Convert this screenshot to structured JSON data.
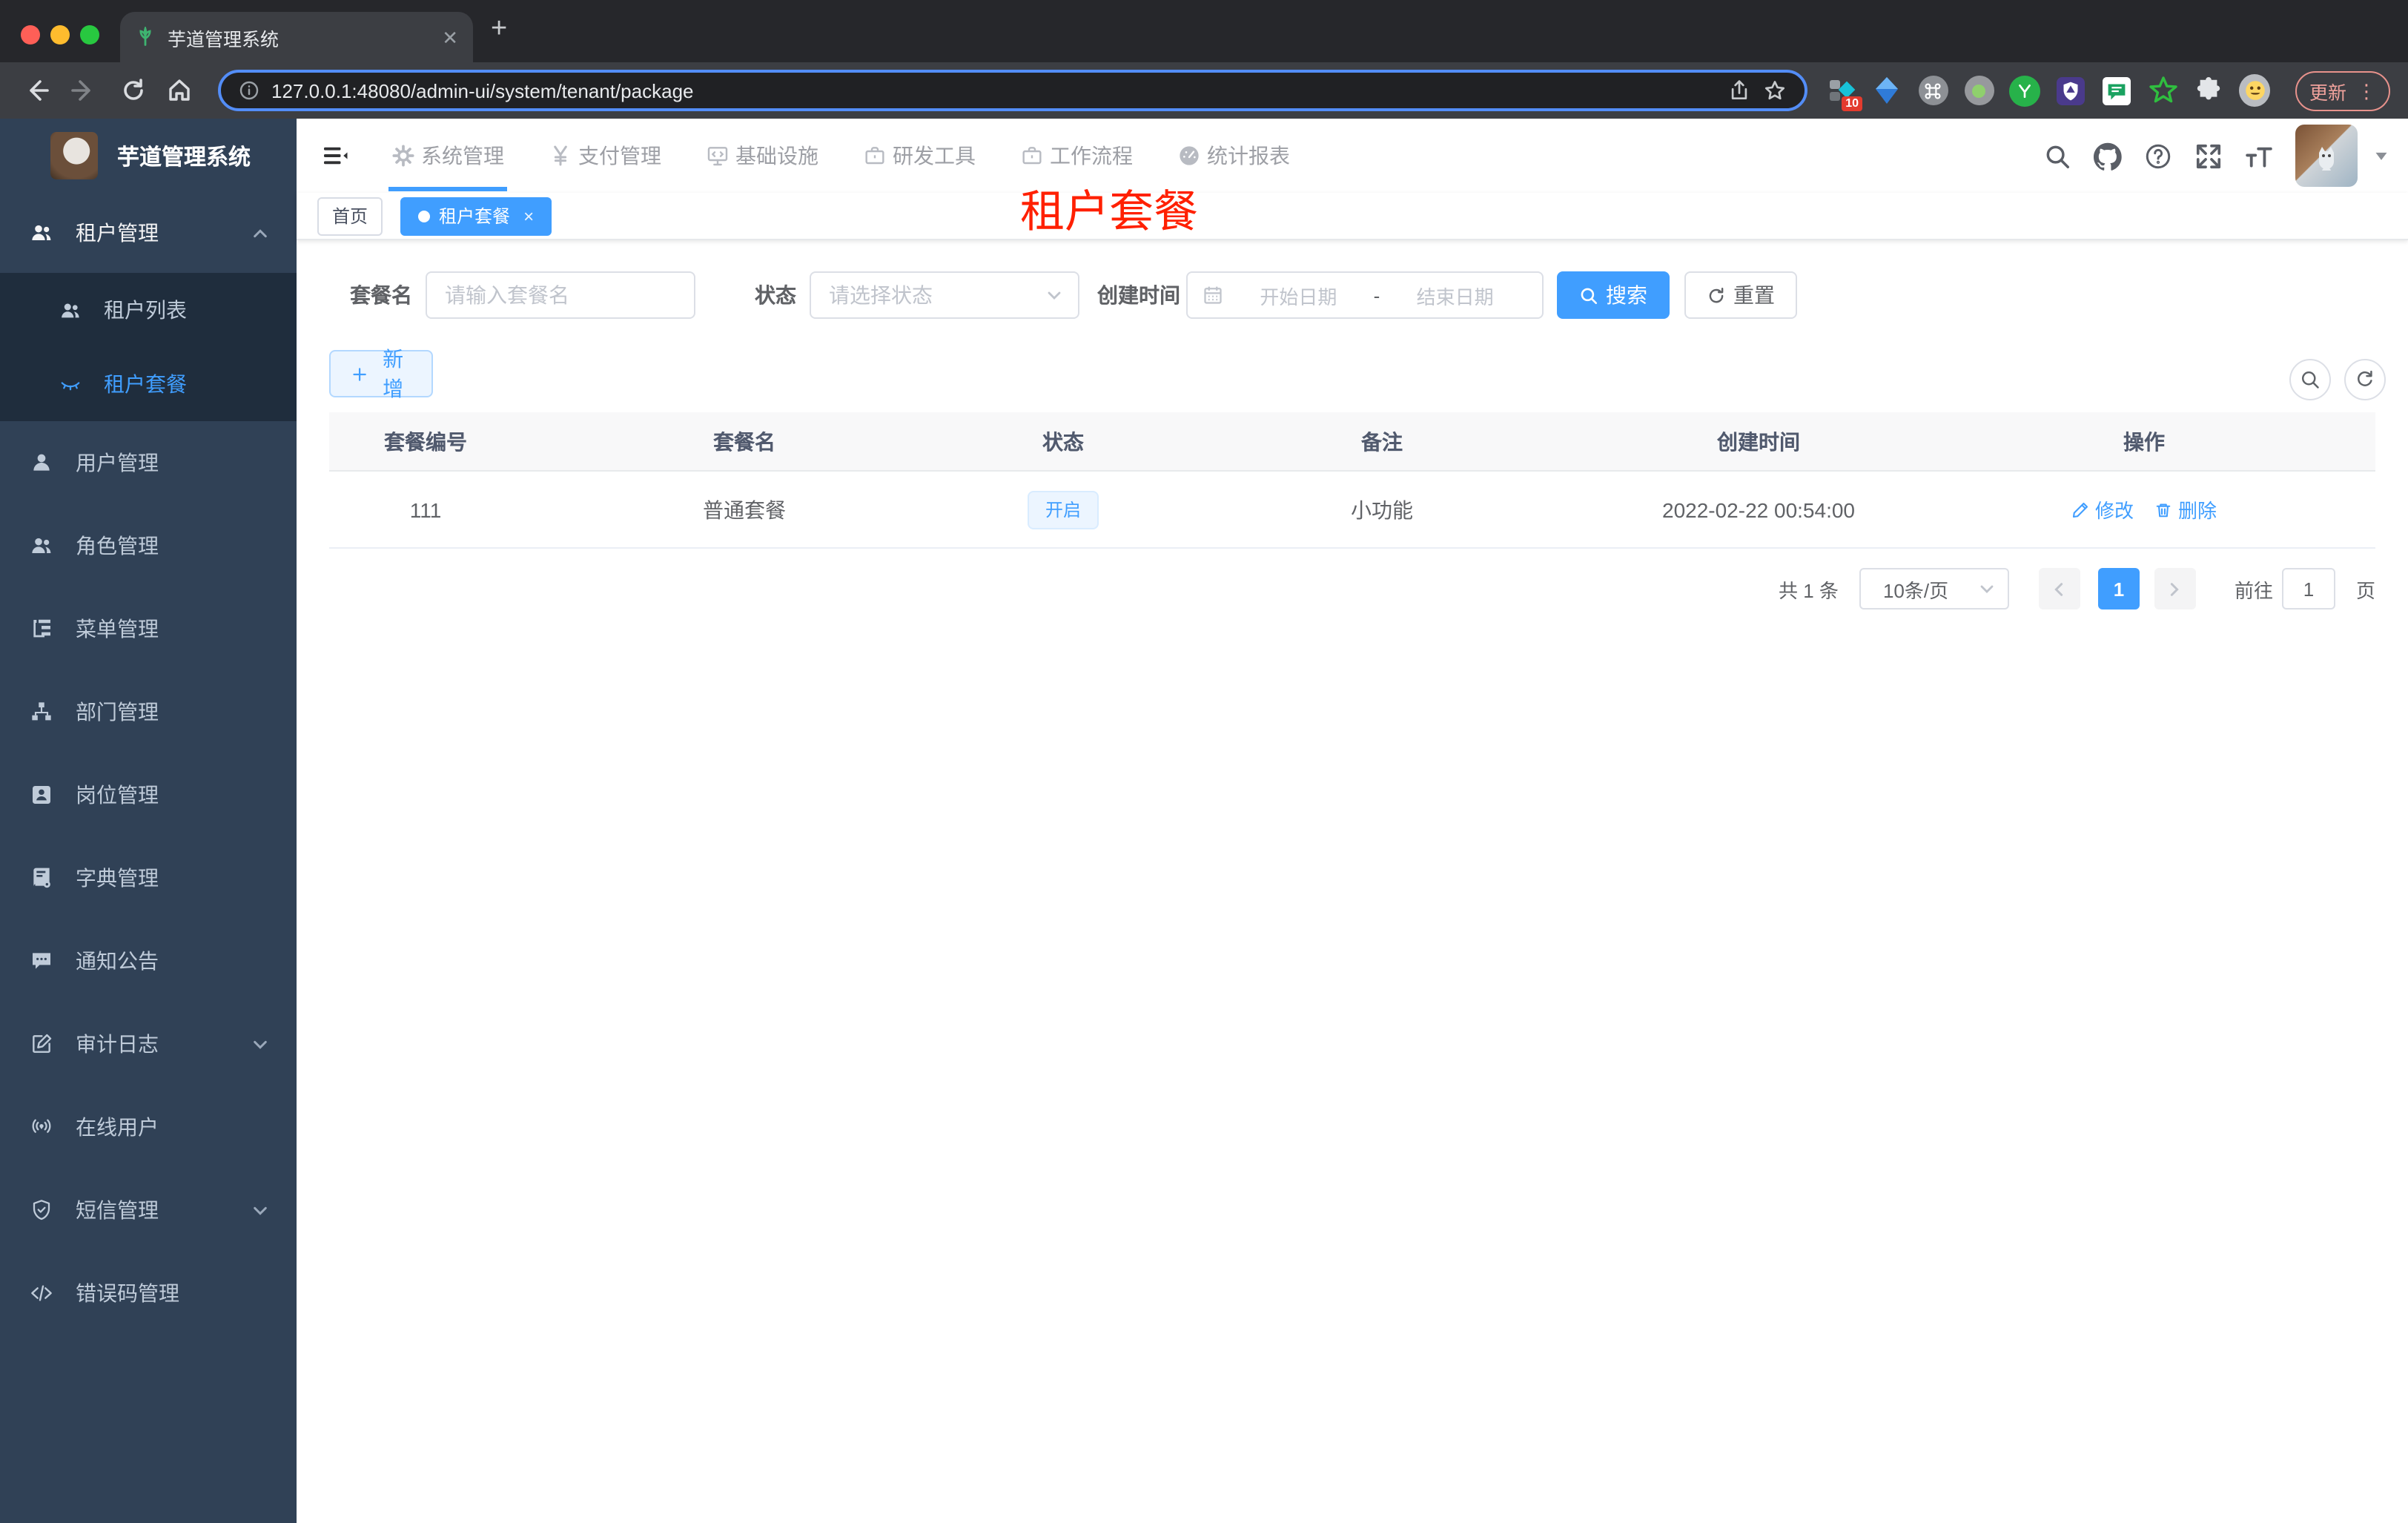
{
  "browser": {
    "tab_title": "芋道管理系统",
    "url": "127.0.0.1:48080/admin-ui/system/tenant/package",
    "ext_badge": "10",
    "update_label": "更新",
    "menu_dots": "⋮",
    "close_glyph": "✕",
    "newtab_glyph": "+"
  },
  "app": {
    "logo_title": "芋道管理系统",
    "overlay_title": "租户套餐",
    "colors": {
      "accent": "#409eff",
      "overlay_red": "#ff2000",
      "sidebar_bg": "#304156",
      "submenu_bg": "#1f2d3d"
    }
  },
  "nav": {
    "items": [
      {
        "label": "系统管理"
      },
      {
        "label": "支付管理"
      },
      {
        "label": "基础设施"
      },
      {
        "label": "研发工具"
      },
      {
        "label": "工作流程"
      },
      {
        "label": "统计报表"
      }
    ]
  },
  "tags": {
    "home": "首页",
    "active": "租户套餐",
    "close_glyph": "×"
  },
  "sidebar": {
    "items": [
      {
        "label": "租户管理"
      },
      {
        "label": "租户列表"
      },
      {
        "label": "租户套餐"
      },
      {
        "label": "用户管理"
      },
      {
        "label": "角色管理"
      },
      {
        "label": "菜单管理"
      },
      {
        "label": "部门管理"
      },
      {
        "label": "岗位管理"
      },
      {
        "label": "字典管理"
      },
      {
        "label": "通知公告"
      },
      {
        "label": "审计日志"
      },
      {
        "label": "在线用户"
      },
      {
        "label": "短信管理"
      },
      {
        "label": "错误码管理"
      }
    ]
  },
  "filters": {
    "name_label": "套餐名",
    "name_placeholder": "请输入套餐名",
    "status_label": "状态",
    "status_placeholder": "请选择状态",
    "date_label": "创建时间",
    "date_start_placeholder": "开始日期",
    "date_separator": "-",
    "date_end_placeholder": "结束日期",
    "search_label": "搜索",
    "reset_label": "重置"
  },
  "toolbar": {
    "add_label": "新增"
  },
  "table": {
    "columns": [
      "套餐编号",
      "套餐名",
      "状态",
      "备注",
      "创建时间",
      "操作"
    ],
    "row": {
      "id": "111",
      "name": "普通套餐",
      "status": "开启",
      "remark": "小功能",
      "created": "2022-02-22 00:54:00",
      "edit_label": "修改",
      "delete_label": "删除"
    }
  },
  "pagination": {
    "total": "共 1 条",
    "size": "10条/页",
    "page": "1",
    "goto_label": "前往",
    "goto_value": "1",
    "unit_label": "页"
  }
}
